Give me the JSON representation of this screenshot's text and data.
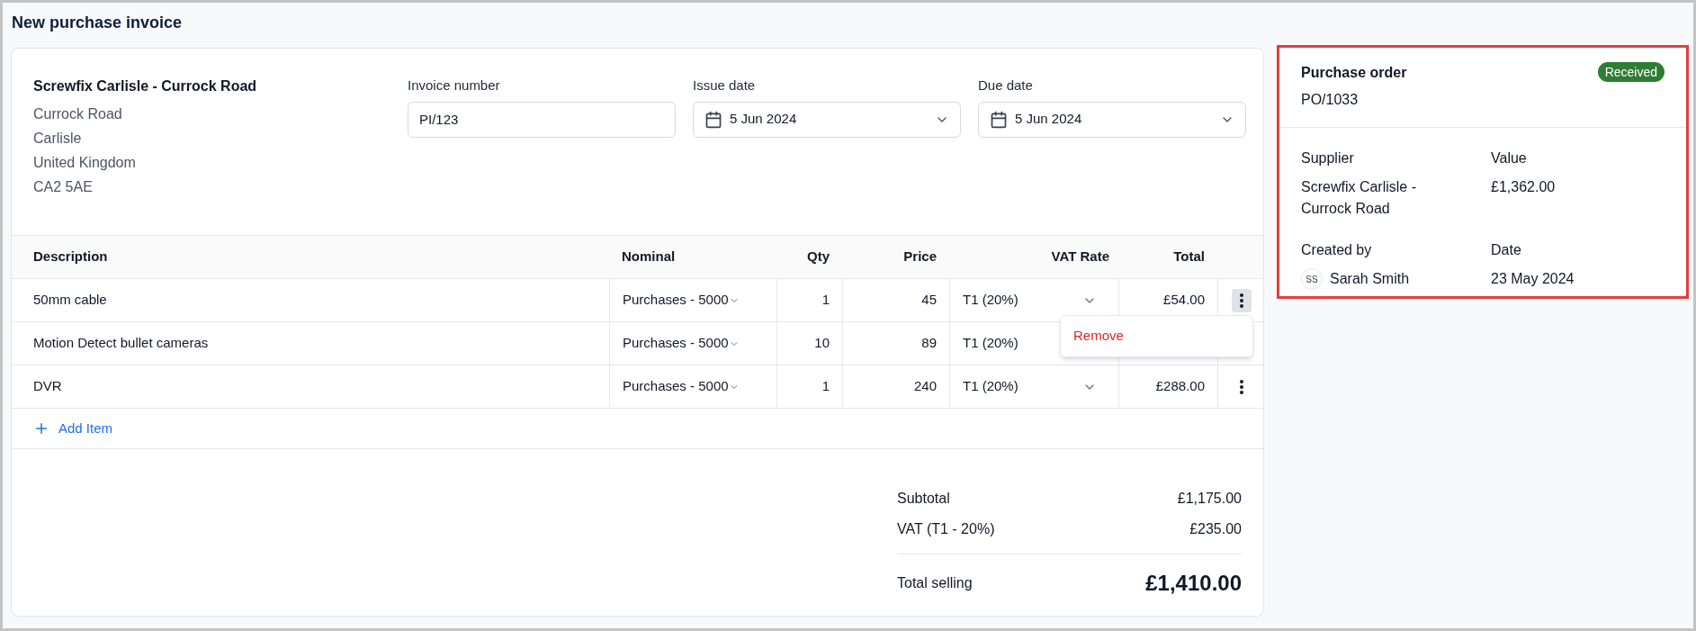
{
  "page": {
    "title": "New purchase invoice"
  },
  "supplier": {
    "name": "Screwfix Carlisle - Currock Road",
    "address_lines": [
      "Currock Road",
      "Carlisle",
      "United Kingdom",
      "CA2 5AE"
    ]
  },
  "fields": [
    {
      "kind": "text",
      "label": "Invoice number",
      "value": "PI/123"
    },
    {
      "kind": "date",
      "label": "Issue date",
      "value": "5 Jun 2024"
    },
    {
      "kind": "date",
      "label": "Due date",
      "value": "5 Jun 2024"
    }
  ],
  "table": {
    "columns": [
      "Description",
      "Nominal",
      "Qty",
      "Price",
      "VAT Rate",
      "Total"
    ],
    "rows": [
      {
        "description": "50mm cable",
        "nominal": "Purchases - 5000",
        "qty": "1",
        "price": "45",
        "vat_rate": "T1 (20%)",
        "total": "£54.00",
        "menu_open": true
      },
      {
        "description": "Motion Detect bullet cameras",
        "nominal": "Purchases - 5000",
        "qty": "10",
        "price": "89",
        "vat_rate": "T1 (20%)",
        "menu_open": false
      },
      {
        "description": "DVR",
        "nominal": "Purchases - 5000",
        "qty": "1",
        "price": "240",
        "vat_rate": "T1 (20%)",
        "total": "£288.00",
        "menu_open": false
      }
    ],
    "row_menu_items": [
      "Remove"
    ],
    "add_item": "Add Item"
  },
  "totals": [
    {
      "kind": "line",
      "label": "Subtotal",
      "value": "£1,175.00"
    },
    {
      "kind": "line",
      "label": "VAT (T1 - 20%)",
      "value": "£235.00"
    },
    {
      "kind": "grand",
      "label": "Total selling",
      "value": "£1,410.00"
    }
  ],
  "purchase_order": {
    "title": "Purchase order",
    "number": "PO/1033",
    "status": "Received",
    "details": [
      {
        "kind": "text",
        "label": "Supplier",
        "value": "Screwfix Carlisle - Currock Road"
      },
      {
        "kind": "text",
        "label": "Value",
        "value": "£1,362.00"
      },
      {
        "kind": "person",
        "label": "Created by",
        "initials": "SS",
        "value": "Sarah Smith"
      },
      {
        "kind": "text",
        "label": "Date",
        "value": "23 May 2024"
      }
    ]
  }
}
